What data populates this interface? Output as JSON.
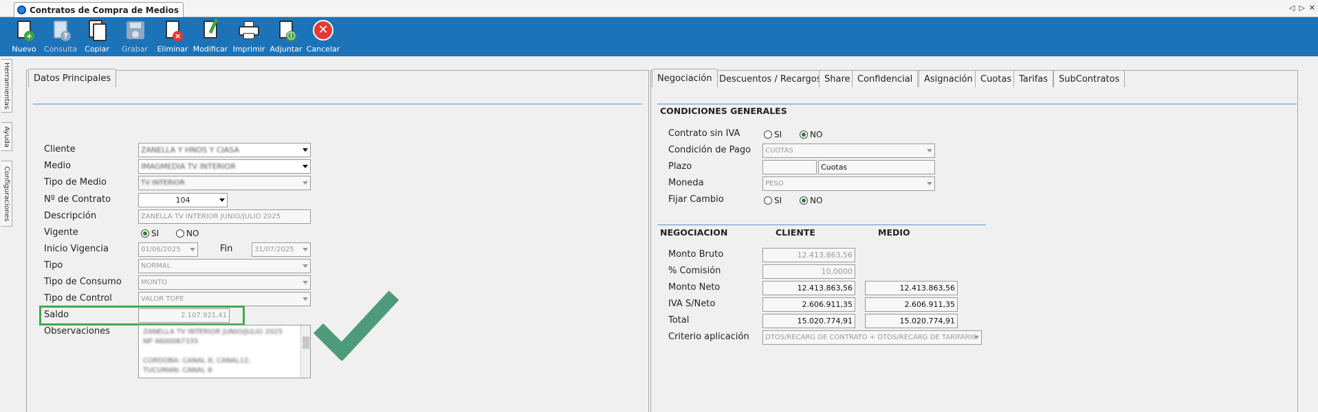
{
  "window": {
    "title": "Contratos de Compra de Medios"
  },
  "toolbar": {
    "buttons": [
      {
        "label": "Nuevo",
        "icon": "new-icon",
        "enabled": true
      },
      {
        "label": "Consulta",
        "icon": "query-icon",
        "enabled": false
      },
      {
        "label": "Copiar",
        "icon": "copy-icon",
        "enabled": true
      },
      {
        "label": "Grabar",
        "icon": "save-icon",
        "enabled": false
      },
      {
        "label": "Eliminar",
        "icon": "delete-icon",
        "enabled": true
      },
      {
        "label": "Modificar",
        "icon": "edit-icon",
        "enabled": true
      },
      {
        "label": "Imprimir",
        "icon": "print-icon",
        "enabled": true
      },
      {
        "label": "Adjuntar",
        "icon": "attach-icon",
        "enabled": true
      },
      {
        "label": "Cancelar",
        "icon": "cancel-icon",
        "enabled": true
      }
    ]
  },
  "sidetabs": [
    "Herramientas",
    "Ayuda",
    "Configuraciones"
  ],
  "left": {
    "tab": "Datos Principales",
    "labels": {
      "cliente": "Cliente",
      "medio": "Medio",
      "tipo_medio": "Tipo de Medio",
      "num_contrato": "Nº de Contrato",
      "descripcion": "Descripción",
      "vigente": "Vigente",
      "inicio": "Inicio Vigencia",
      "fin": "Fin",
      "tipo": "Tipo",
      "tipo_consumo": "Tipo de Consumo",
      "tipo_control": "Tipo de Control",
      "saldo": "Saldo",
      "observaciones": "Observaciones"
    },
    "values": {
      "cliente": "ZANELLA Y HNOS Y CIASA",
      "medio": "IMAGMEDIA TV INTERIOR",
      "tipo_medio": "TV INTERIOR",
      "num_contrato": "104",
      "descripcion": "ZANELLA TV INTERIOR JUNIO/JULIO 2025",
      "vigente_si": "SI",
      "vigente_no": "NO",
      "inicio": "01/06/2025",
      "fin": "31/07/2025",
      "tipo": "NORMAL",
      "tipo_consumo": "MONTO",
      "tipo_control": "VALOR TOPE",
      "saldo": "2.107.921,41",
      "obs_lines": [
        "ZANELLA TV INTERIOR JUNIO/JULIO 2025",
        "NP 4600067335",
        "",
        "CORDOBA: CANAL 8, CANAL12,",
        "TUCUMAN: CANAL 8"
      ]
    }
  },
  "right": {
    "tabs": [
      "Negociación",
      "Descuentos / Recargos",
      "Share",
      "Confidencial",
      "Asignación",
      "Cuotas",
      "Tarifas",
      "SubContratos"
    ],
    "condiciones": {
      "title": "CONDICIONES GENERALES",
      "contrato_sin_iva": "Contrato sin IVA",
      "condicion_pago": "Condición de Pago",
      "condicion_pago_value": "CUOTAS",
      "plazo": "Plazo",
      "plazo_value": "",
      "plazo_unit": "Cuotas",
      "moneda": "Moneda",
      "moneda_value": "PESO",
      "fijar_cambio": "Fijar Cambio",
      "si": "SI",
      "no": "NO"
    },
    "negociacion": {
      "title": "NEGOCIACION",
      "col_cliente": "CLIENTE",
      "col_medio": "MEDIO",
      "monto_bruto": "Monto Bruto",
      "pct_comision": "% Comisión",
      "monto_neto": "Monto Neto",
      "iva_neto": "IVA S/Neto",
      "total": "Total",
      "criterio": "Criterio aplicación",
      "cliente_monto_bruto": "12.413.863,56",
      "cliente_pct_comision": "10,0000",
      "cliente_monto_neto": "12.413.863,56",
      "cliente_iva_neto": "2.606.911,35",
      "cliente_total": "15.020.774,91",
      "medio_monto_neto": "12.413.863,56",
      "medio_iva_neto": "2.606.911,35",
      "medio_total": "15.020.774,91",
      "criterio_value": "DTOS/RECARG DE CONTRATO + DTOS/RECARG DE TARIFARIO"
    }
  },
  "colors": {
    "toolbar": "#1d73b8",
    "highlight": "#3daa4f",
    "checkmark": "#4e9b7c"
  }
}
